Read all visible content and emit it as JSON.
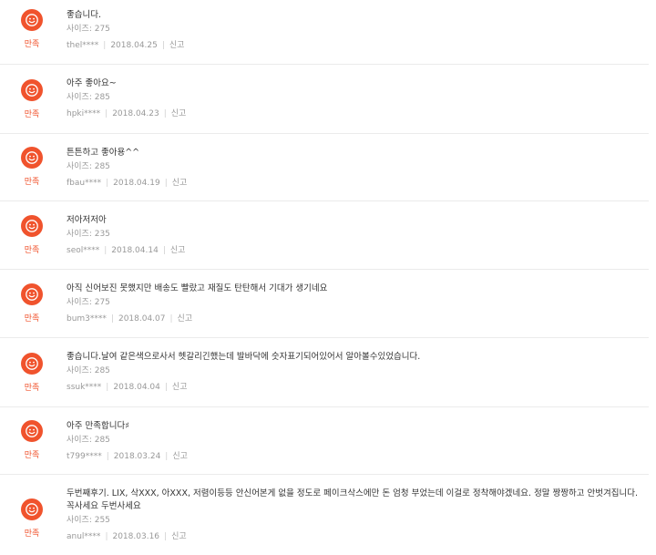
{
  "satisfaction_label": "만족",
  "size_prefix": "사이즈: ",
  "report_label": "신고",
  "reviews": [
    {
      "text": "좋습니다.",
      "size": "275",
      "user": "thel****",
      "date": "2018.04.25"
    },
    {
      "text": "아주 좋아요~",
      "size": "285",
      "user": "hpki****",
      "date": "2018.04.23"
    },
    {
      "text": "튼튼하고 좋아용^^",
      "size": "285",
      "user": "fbau****",
      "date": "2018.04.19"
    },
    {
      "text": "저아저저아",
      "size": "235",
      "user": "seol****",
      "date": "2018.04.14"
    },
    {
      "text": "아직 신어보진 못했지만 배송도 빨랐고 재질도 탄탄해서 기대가 생기네요",
      "size": "275",
      "user": "bum3****",
      "date": "2018.04.07"
    },
    {
      "text": "좋습니다.날여 같은색으로사서 헷갈리긴했는데 발바닥에 숫자표기되어있어서 알아볼수있었습니다.",
      "size": "285",
      "user": "ssuk****",
      "date": "2018.04.04"
    },
    {
      "text": "아주 만족합니다♯",
      "size": "285",
      "user": "t799****",
      "date": "2018.03.24"
    },
    {
      "text": "두번째후기. LIX, 삭XXX, 아XXX, 저렴이등등 안신어본게 없을 정도로 페이크삭스에만 돈 엄청 부었는데 이걸로 정착해야겠네요. 정말 짱짱하고 안벗겨집니다. 꼭사세요 두번사세요",
      "size": "255",
      "user": "anul****",
      "date": "2018.03.16"
    }
  ],
  "colors": {
    "accent": "#f0532d",
    "muted": "#999999",
    "divider": "#ebebeb"
  },
  "icons": {
    "badge": "smiley-icon"
  }
}
